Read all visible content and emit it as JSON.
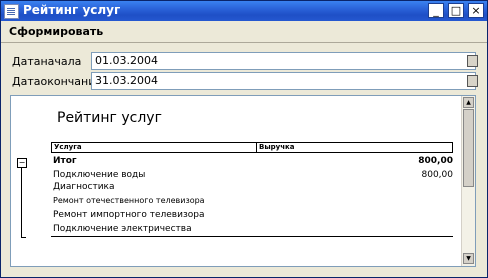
{
  "window": {
    "title": "Рейтинг услуг",
    "minimize_glyph": "_",
    "maximize_glyph": "□",
    "close_glyph": "×"
  },
  "toolbar": {
    "generate_label": "Сформировать"
  },
  "form": {
    "start_label": "Датаначала",
    "start_value": "01.03.2004",
    "end_label": "Датаокончания",
    "end_value": "31.03.2004"
  },
  "report": {
    "title": "Рейтинг услуг",
    "columns": [
      "Услуга",
      "Выручка"
    ],
    "total": {
      "name": "Итог",
      "value": "800,00"
    },
    "rows": [
      {
        "name": "Подключение воды",
        "value": "800,00"
      },
      {
        "name": "Диагностика",
        "value": ""
      },
      {
        "name": "Ремонт отечественного телевизора",
        "value": ""
      },
      {
        "name": "Ремонт импортного телевизора",
        "value": ""
      },
      {
        "name": "Подключение электричества",
        "value": ""
      }
    ],
    "group_toggle": "−"
  }
}
